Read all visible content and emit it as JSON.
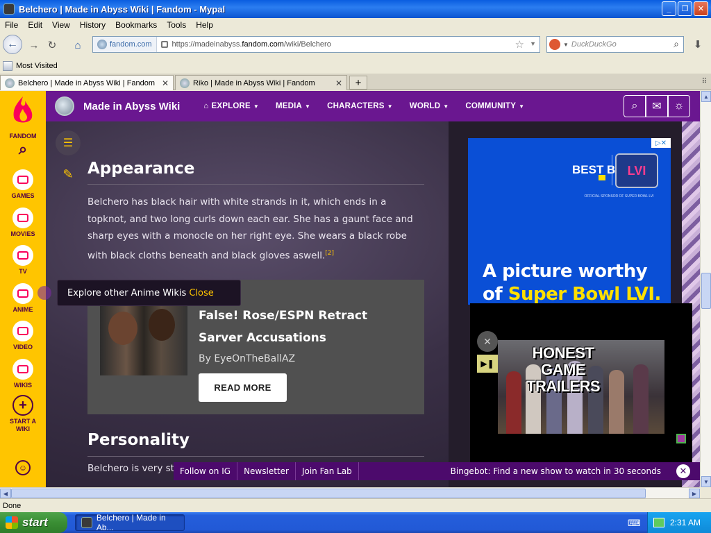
{
  "window": {
    "title": "Belchero | Made in Abyss Wiki | Fandom - Mypal",
    "minimize": "_",
    "maximize": "❐",
    "close": "✕"
  },
  "menu": [
    "File",
    "Edit",
    "View",
    "History",
    "Bookmarks",
    "Tools",
    "Help"
  ],
  "nav": {
    "site_identity": "fandom.com",
    "url_prefix": "https://madeinabyss.",
    "url_domain": "fandom.com",
    "url_path": "/wiki/Belchero",
    "search_placeholder": "DuckDuckGo"
  },
  "bookmarks": {
    "most_visited": "Most Visited"
  },
  "tabs": [
    {
      "label": "Belchero | Made in Abyss Wiki | Fandom",
      "active": true
    },
    {
      "label": "Riko | Made in Abyss Wiki | Fandom",
      "active": false
    }
  ],
  "fandom_sidebar": {
    "logo_label": "FANDOM",
    "items": [
      {
        "label": "GAMES"
      },
      {
        "label": "MOVIES"
      },
      {
        "label": "TV"
      },
      {
        "label": "ANIME"
      },
      {
        "label": "VIDEO"
      },
      {
        "label": "WIKIS"
      },
      {
        "label": "START A WIKI"
      }
    ]
  },
  "wiki_header": {
    "name": "Made in Abyss Wiki",
    "nav": [
      "EXPLORE",
      "MEDIA",
      "CHARACTERS",
      "WORLD",
      "COMMUNITY"
    ]
  },
  "article": {
    "section1_title": "Appearance",
    "section1_text": "Belchero has black hair with white strands in it, which ends in a topknot, and two long curls down each ear. She has a gaunt face and sharp eyes with a monocle on her right eye. She wears a black robe with black cloths beneath and black gloves aswell.",
    "section1_ref": "[2]",
    "section2_title": "Personality",
    "section2_text": "Belchero is very str"
  },
  "promo": {
    "title": "False! Rose/ESPN Retract Sarver Accusations",
    "byline": "By EyeOnTheBallAZ",
    "cta": "READ MORE"
  },
  "tooltip": {
    "text": "Explore other Anime Wikis",
    "close": "Close"
  },
  "ad": {
    "brand": "BEST BUY",
    "badge": "LVI",
    "sponsor_line": "OFFICIAL SPONSOR OF SUPER BOWL LVI",
    "tagline_1": "A picture worthy",
    "tagline_2": "of ",
    "tagline_hl": "Super Bowl LVI."
  },
  "video": {
    "title_line1": "HONEST",
    "title_line2": "GAME",
    "title_line3": "TRAILERS"
  },
  "fan_feed": {
    "links": [
      "Follow on IG",
      "Newsletter",
      "Join Fan Lab"
    ],
    "bingebot": "Bingebot: Find a new show to watch in 30 seconds"
  },
  "status": {
    "text": "Done"
  },
  "taskbar": {
    "start": "start",
    "item": "Belchero | Made in Ab...",
    "clock": "2:31 AM"
  },
  "colors": {
    "fandom_yellow": "#ffc500",
    "wiki_purple": "#6a1790",
    "link_gold": "#ffc500",
    "ad_blue": "#0a4fd6"
  }
}
